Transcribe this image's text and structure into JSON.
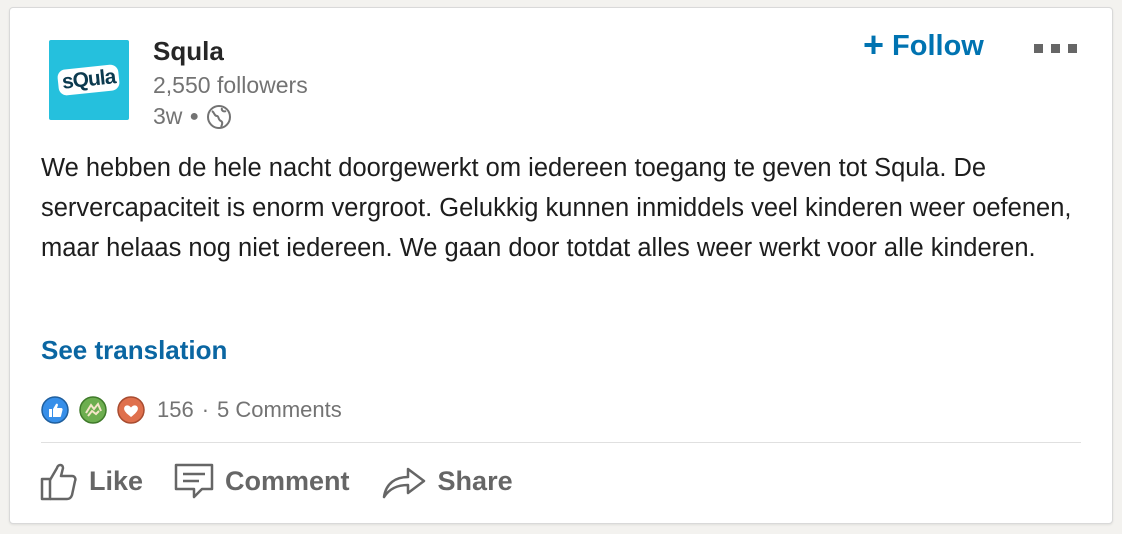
{
  "post": {
    "company": "Squla",
    "logo_text": "sQula",
    "followers": "2,550 followers",
    "age": "3w",
    "visibility_icon": "globe-icon",
    "follow_label": "Follow",
    "text": "We hebben de hele nacht doorgewerkt om iedereen toegang te geven tot Squla. De servercapaciteit is enorm vergroot. Gelukkig kunnen inmiddels veel kinderen weer oefenen, maar helaas nog niet iedereen. We gaan door totdat alles weer werkt voor alle kinderen.",
    "see_translation": "See translation",
    "reaction_icons": [
      "like-reaction-icon",
      "celebrate-reaction-icon",
      "love-reaction-icon"
    ],
    "reaction_count": "156",
    "comments_count": "5 Comments"
  },
  "actions": {
    "like": "Like",
    "comment": "Comment",
    "share": "Share"
  },
  "colors": {
    "accent": "#0073b1",
    "logo_bg": "#25c0dd",
    "like_reaction": "#378fe9",
    "celebrate_reaction": "#6dae4f",
    "love_reaction": "#df704d"
  }
}
